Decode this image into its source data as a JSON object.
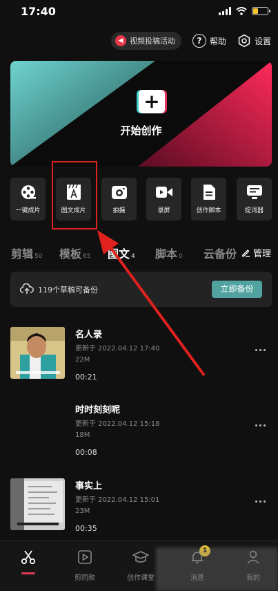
{
  "status": {
    "time": "17:40",
    "battery": 0.3
  },
  "top_actions": {
    "promo": "视频投稿活动",
    "help": "帮助",
    "settings": "设置"
  },
  "hero": {
    "plus": "+",
    "label": "开始创作"
  },
  "tools": [
    {
      "label": "一键成片",
      "icon": "film-reel-icon"
    },
    {
      "label": "图文成片",
      "icon": "text-to-video-icon"
    },
    {
      "label": "拍摄",
      "icon": "camera-icon"
    },
    {
      "label": "录屏",
      "icon": "screen-record-icon"
    },
    {
      "label": "创作脚本",
      "icon": "script-icon"
    },
    {
      "label": "提词器",
      "icon": "teleprompter-icon"
    }
  ],
  "tabs": [
    {
      "label": "剪辑",
      "count": "50"
    },
    {
      "label": "模板",
      "count": "65"
    },
    {
      "label": "图文",
      "count": "4"
    },
    {
      "label": "脚本",
      "count": "0"
    },
    {
      "label": "云备份",
      "count": ""
    }
  ],
  "manage": "管理",
  "backup": {
    "text": "119个草稿可备份",
    "button": "立即备份"
  },
  "drafts": [
    {
      "title": "名人录",
      "updated": "更新于 2022.04.12 17:40",
      "size": "22M",
      "duration": "00:21"
    },
    {
      "title": "时时刻刻呢",
      "updated": "更新于 2022.04.12 15:18",
      "size": "18M",
      "duration": "00:08"
    },
    {
      "title": "事实上",
      "updated": "更新于 2022.04.12 15:01",
      "size": "23M",
      "duration": "00:35"
    }
  ],
  "nav": [
    {
      "label": "",
      "icon": "scissors-icon"
    },
    {
      "label": "剪同款",
      "icon": "template-icon"
    },
    {
      "label": "创作课堂",
      "icon": "graduation-cap-icon"
    },
    {
      "label": "消息",
      "icon": "bell-icon",
      "badge": "1"
    },
    {
      "label": "我的",
      "icon": "user-icon"
    }
  ],
  "colors": {
    "accent": "#51a3a0",
    "highlight": "#e0221f",
    "badge": "#f3c52f"
  }
}
